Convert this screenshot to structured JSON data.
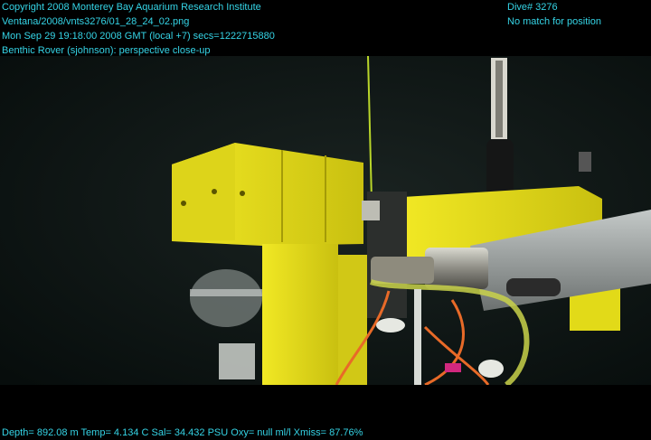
{
  "header": {
    "copyright": "Copyright 2008 Monterey Bay Aquarium Research Institute",
    "file_path": "Ventana/2008/vnts3276/01_28_24_02.png",
    "timestamp": "Mon Sep 29 19:18:00 2008 GMT (local +7)  secs=1222715880",
    "subject": "Benthic Rover (sjohnson): perspective close-up",
    "dive": "Dive# 3276",
    "position_status": "No match for position"
  },
  "footer": {
    "telemetry": "Depth= 892.08 m  Temp= 4.134 C  Sal= 34.432 PSU  Oxy= null ml/l  Xmiss= 87.76%"
  },
  "scene": {
    "description_icon": "underwater-rover-photo",
    "colors": {
      "water": "#0c1514",
      "yellow_frame": "#e9e21a",
      "overlay_text": "#35d4e6"
    }
  }
}
